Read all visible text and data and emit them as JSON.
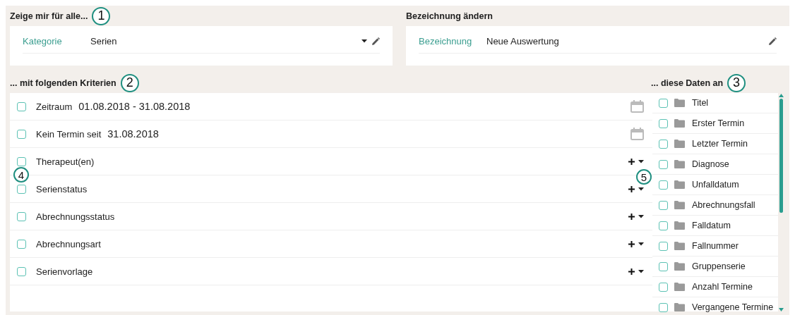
{
  "sections": [
    {
      "heading": "Zeige mir für alle...",
      "callout": "1",
      "field": {
        "label": "Kategorie",
        "value": "Serien",
        "dropdown": true
      }
    },
    {
      "heading": "Bezeichnung ändern",
      "field": {
        "label": "Bezeichnung",
        "value": "Neue Auswertung",
        "dropdown": false
      }
    }
  ],
  "criteria": {
    "heading": "... mit folgenden Kriterien",
    "callout": "2",
    "rows": [
      {
        "kind": "date",
        "label": "Zeitraum",
        "value": "01.08.2018 - 31.08.2018",
        "checked": false
      },
      {
        "kind": "date",
        "label": "Kein Termin seit",
        "value": "31.08.2018",
        "checked": false
      },
      {
        "kind": "filter",
        "label": "Therapeut(en)",
        "checked": false
      },
      {
        "kind": "filter",
        "label": "Serienstatus",
        "checked": false
      },
      {
        "kind": "filter",
        "label": "Abrechnungsstatus",
        "checked": false
      },
      {
        "kind": "filter",
        "label": "Abrechnungsart",
        "checked": false
      },
      {
        "kind": "filter",
        "label": "Serienvorlage",
        "checked": false
      }
    ],
    "overlay_callout": "4"
  },
  "data_fields": {
    "heading": "... diese Daten an",
    "callout": "3",
    "overlay_callout": "5",
    "items": [
      {
        "label": "Titel",
        "checked": false
      },
      {
        "label": "Erster Termin",
        "checked": false
      },
      {
        "label": "Letzter Termin",
        "checked": false
      },
      {
        "label": "Diagnose",
        "checked": false
      },
      {
        "label": "Unfalldatum",
        "checked": false
      },
      {
        "label": "Abrechnungsfall",
        "checked": false
      },
      {
        "label": "Falldatum",
        "checked": false
      },
      {
        "label": "Fallnummer",
        "checked": false
      },
      {
        "label": "Gruppenserie",
        "checked": false
      },
      {
        "label": "Anzahl Termine",
        "checked": false
      },
      {
        "label": "Vergangene Termine",
        "checked": false
      }
    ]
  }
}
